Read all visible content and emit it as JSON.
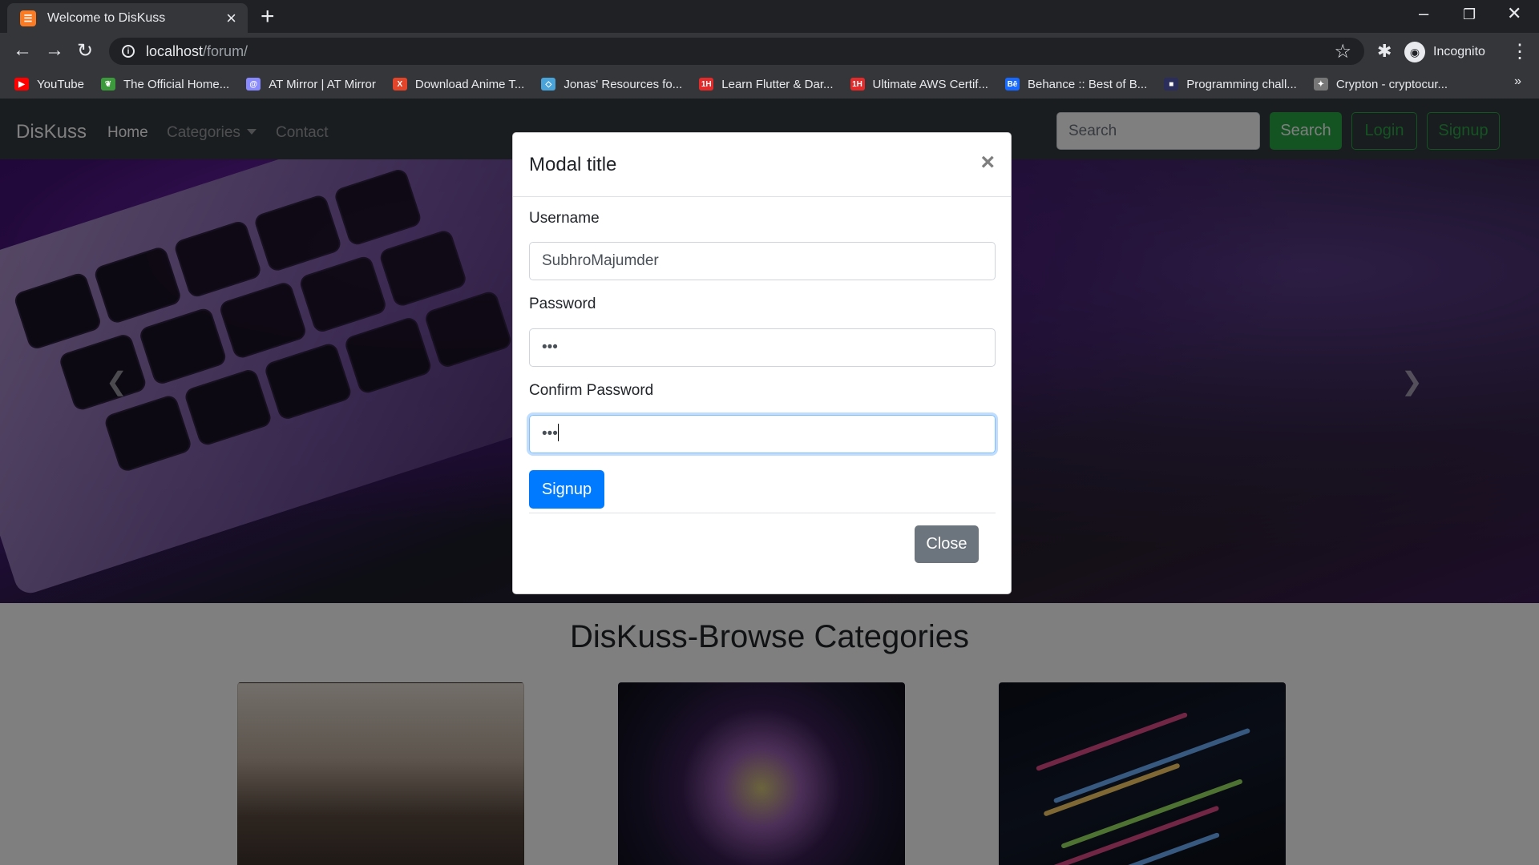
{
  "browser": {
    "tab_title": "Welcome to DisKuss",
    "tab_favicon_text": "☰",
    "new_tab": "+",
    "url_host": "localhost",
    "url_path": "/forum/",
    "profile_label": "Incognito",
    "bookmarks": [
      {
        "label": "YouTube",
        "icon": "youtube-icon",
        "color": "#ff0000"
      },
      {
        "label": "The Official Home...",
        "icon": "leaf-icon",
        "color": "#3c9a3c"
      },
      {
        "label": "AT Mirror | AT Mirror",
        "icon": "at-mirror-icon",
        "color": "#8a8aff"
      },
      {
        "label": "Download Anime T...",
        "icon": "x-icon",
        "color": "#e2452a"
      },
      {
        "label": "Jonas' Resources fo...",
        "icon": "diamond-icon",
        "color": "#4aa3d9"
      },
      {
        "label": "Learn Flutter & Dar...",
        "icon": "1h-icon",
        "color": "#e32b2b"
      },
      {
        "label": "Ultimate AWS Certif...",
        "icon": "1h-icon",
        "color": "#e32b2b"
      },
      {
        "label": "Behance :: Best of B...",
        "icon": "behance-icon",
        "color": "#1769ff"
      },
      {
        "label": "Programming chall...",
        "icon": "square-icon",
        "color": "#2b2d5a"
      },
      {
        "label": "Crypton - cryptocur...",
        "icon": "crypton-icon",
        "color": "#777777"
      }
    ],
    "bookmarks_more": "»"
  },
  "navbar": {
    "brand": "DisKuss",
    "links": [
      {
        "label": "Home",
        "active": true
      },
      {
        "label": "Categories",
        "active": false
      },
      {
        "label": "Contact",
        "active": false
      }
    ],
    "search_placeholder": "Search",
    "search_button": "Search",
    "login_button": "Login",
    "signup_button": "Signup"
  },
  "carousel": {
    "prev": "❮",
    "next": "❯"
  },
  "categories": {
    "heading": "DisKuss-Browse Categories"
  },
  "modal": {
    "title": "Modal title",
    "close_symbol": "×",
    "fields": {
      "username_label": "Username",
      "username_value": "SubhroMajumder",
      "password_label": "Password",
      "password_value": "•••",
      "confirm_label": "Confirm Password",
      "confirm_value": "•••"
    },
    "submit_button": "Signup",
    "close_button": "Close"
  },
  "colors": {
    "navbar_bg": "#343a40",
    "primary": "#007bff",
    "success": "#28a745",
    "secondary": "#6c757d"
  }
}
